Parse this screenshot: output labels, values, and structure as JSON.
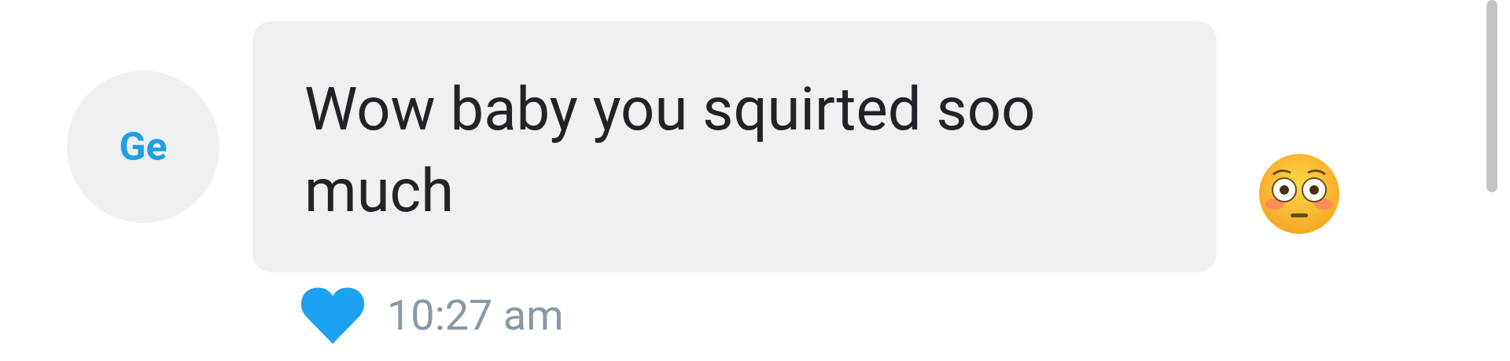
{
  "message": {
    "avatar_initials": "Ge",
    "text": "Wow baby you squirted soo much",
    "liked": true,
    "time": "10:27 am"
  }
}
